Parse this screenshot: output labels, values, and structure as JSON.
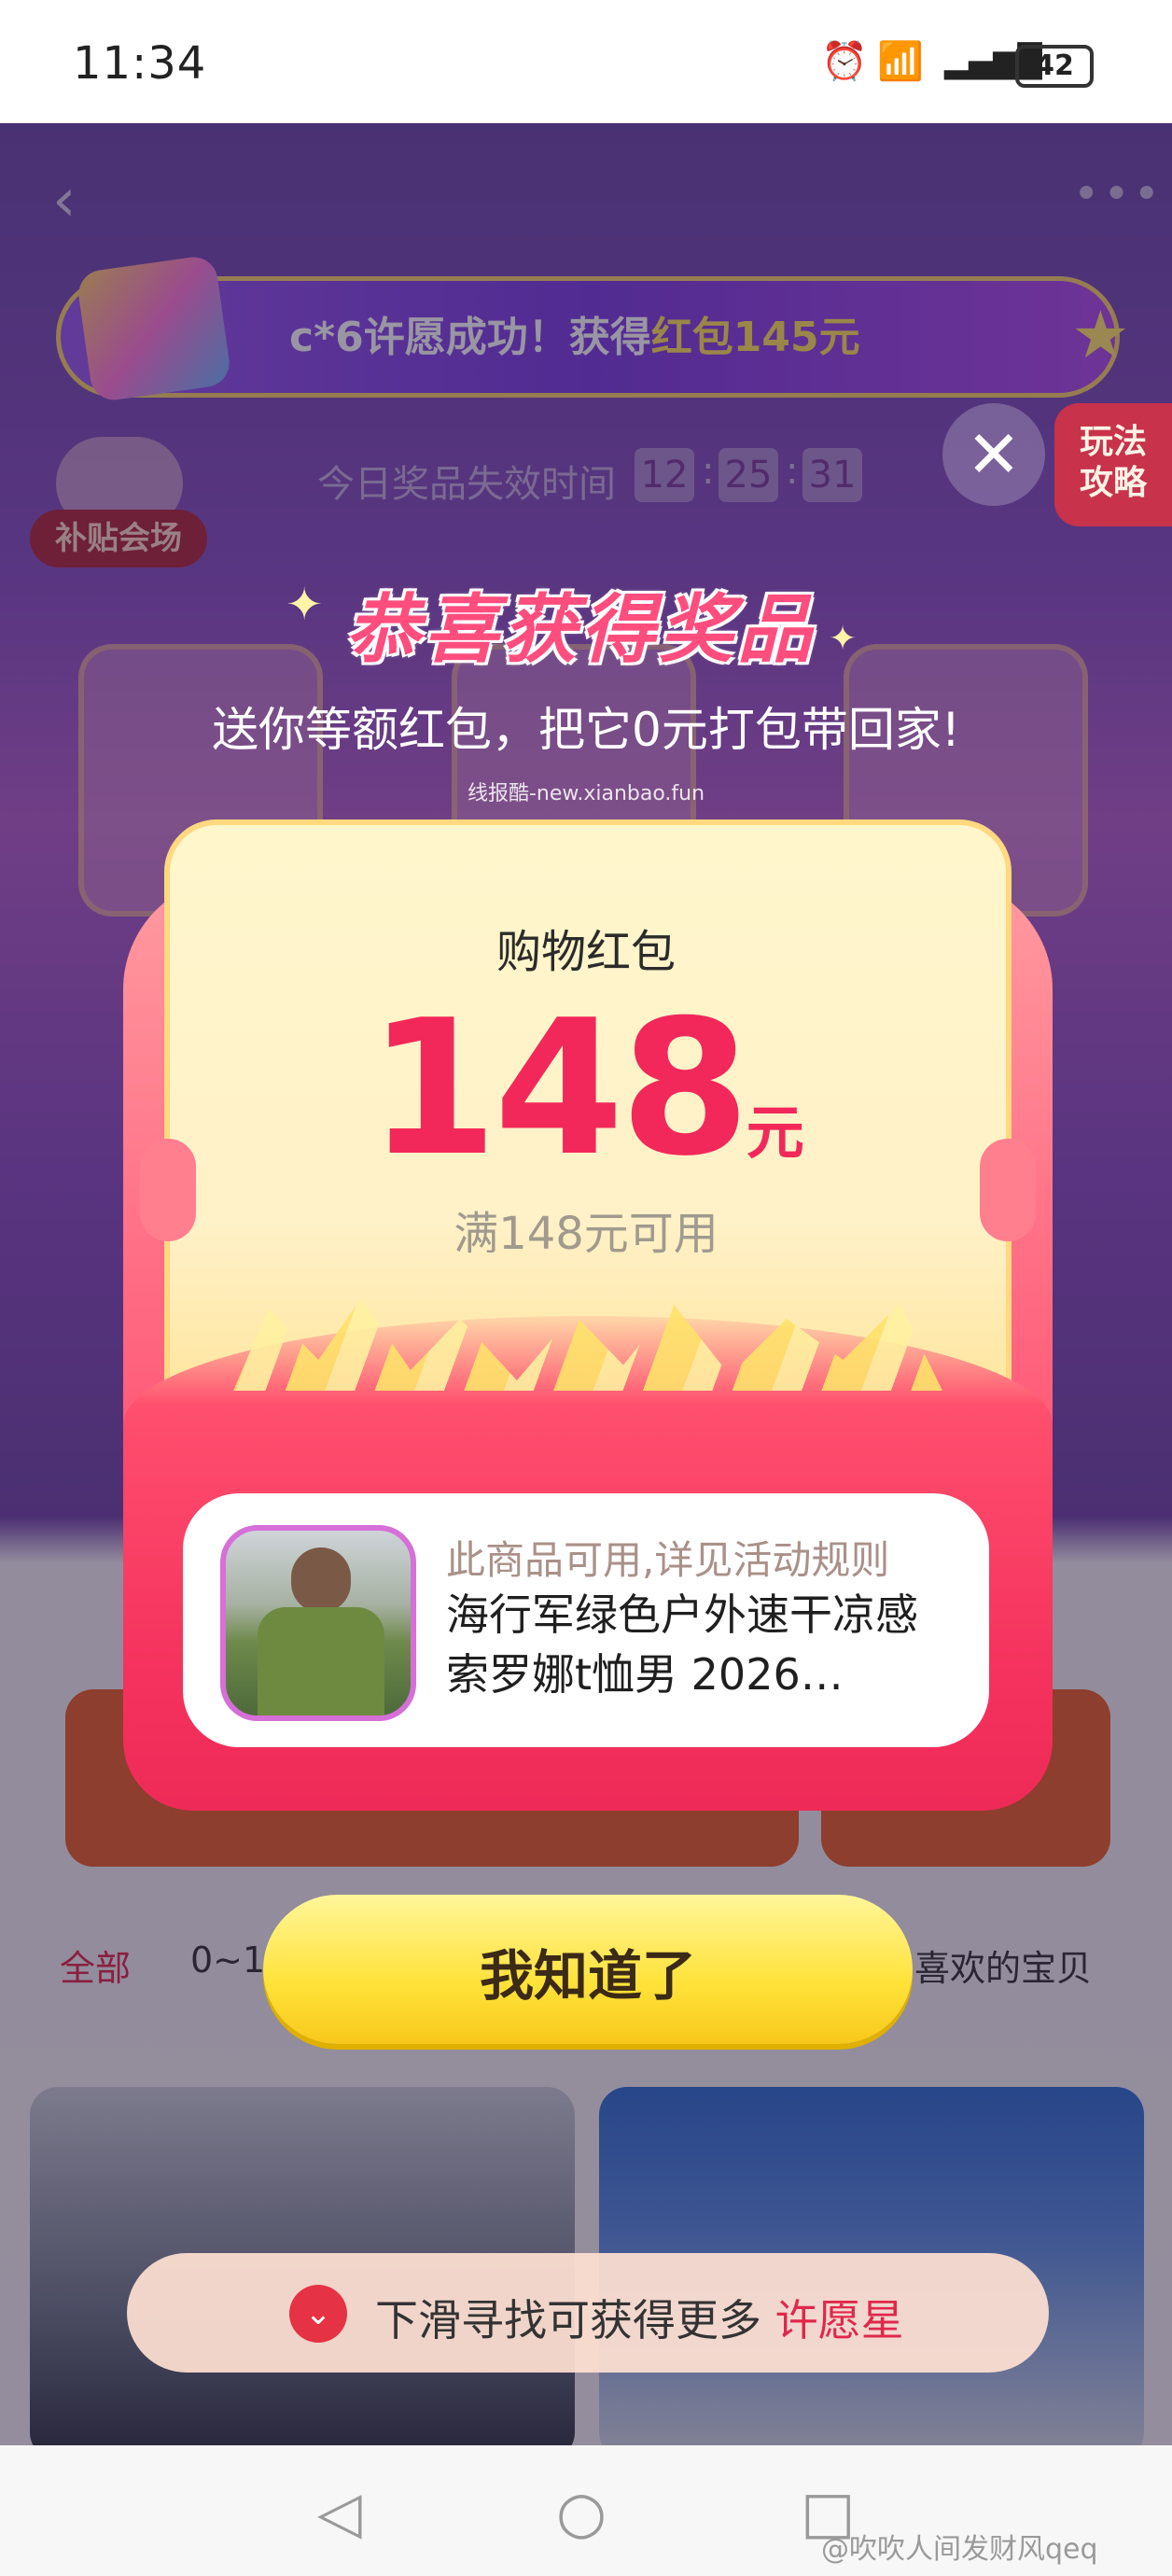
{
  "status_bar": {
    "time": "11:34",
    "battery": "42"
  },
  "banner": {
    "text_prefix": "c*6许愿成功！获得",
    "text_amount": "红包145元"
  },
  "expire": {
    "label": "今日奖品失效时间",
    "hh": "12",
    "mm": "25",
    "ss": "31"
  },
  "side": {
    "subsidy": "补贴会场",
    "guide_line1": "玩法",
    "guide_line2": "攻略"
  },
  "modal": {
    "title": "恭喜获得奖品",
    "subtitle": "送你等额红包，把它0元打包带回家!",
    "watermark": "线报酷-new.xianbao.fun",
    "card_label": "购物红包",
    "amount": "148",
    "amount_unit": "元",
    "threshold": "满148元可用",
    "product_note": "此商品可用,详见活动规则",
    "product_name": "海行军绿色户外速干凉感索罗娜t恤男 2026…",
    "button": "我知道了"
  },
  "background": {
    "tab_all": "全部",
    "tab_range": "0~1",
    "tab_fav": "喜欢的宝贝",
    "slide_tip_prefix": "下滑寻找可获得更多",
    "slide_tip_highlight": "许愿星"
  },
  "credit": "@吹吹人间发财风qeq",
  "colors": {
    "accent_red": "#f2285a",
    "button_yellow": "#ffe238",
    "banner_purple": "#7b3fe0"
  },
  "icons": [
    "back-icon",
    "more-icon",
    "gift-icon",
    "star-icon",
    "close-icon",
    "chevron-down-icon",
    "nav-back-icon",
    "nav-home-icon",
    "nav-recent-icon"
  ]
}
